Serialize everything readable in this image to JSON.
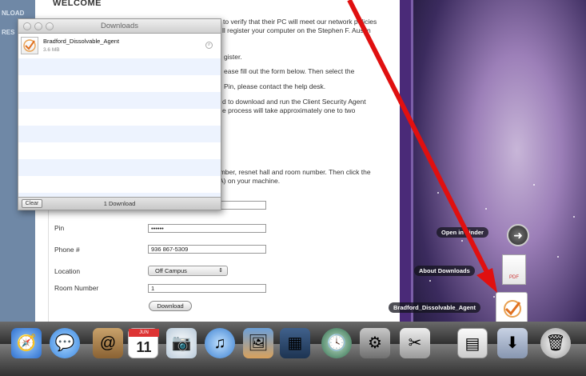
{
  "left_strip": {
    "tab_1": "NLOAD",
    "tab_2": "RES"
  },
  "webpage": {
    "heading": "WELCOME",
    "lines": [
      {
        "id": "l1",
        "text": "to verify that their PC will meet our network policies"
      },
      {
        "id": "l2",
        "text": "ll register your computer on the Stephen F. Austin"
      },
      {
        "id": "l3",
        "text": "gister."
      },
      {
        "id": "l4",
        "text": "ease fill out the form below. Then select the"
      },
      {
        "id": "l5",
        "text": "Pin, please contact the help desk."
      },
      {
        "id": "l6",
        "text": "d to download and run the Client Security Agent"
      },
      {
        "id": "l7",
        "text": "e process will take approximately one to two"
      },
      {
        "id": "l8",
        "text": "umber, resnet hall and room number. Then click the"
      },
      {
        "id": "l9",
        "text": "A) on your machine."
      }
    ],
    "form": {
      "pin_label": "Pin",
      "pin_value": "••••••",
      "phone_label": "Phone #",
      "phone_value": "936 867-5309",
      "location_label": "Location",
      "location_value": "Off Campus",
      "room_label": "Room Number",
      "room_value": "1",
      "download_button": "Download"
    }
  },
  "downloads_window": {
    "title": "Downloads",
    "item_name": "Bradford_Dissolvable_Agent",
    "item_size": "3.6 MB",
    "clear_button": "Clear",
    "count_label": "1 Download"
  },
  "desktop": {
    "open_in_finder": "Open in Finder",
    "about_downloads": "About Downloads",
    "pdf_label": "PDF",
    "agent_label": "Bradford_Dissolvable_Agent",
    "calendar_day": "11",
    "calendar_month": "JUN"
  },
  "icons": {
    "safari": "compass-icon",
    "ichat": "chat-bubble-icon",
    "address_book": "address-book-icon",
    "ical": "calendar-icon",
    "iphoto": "photo-icon",
    "itunes": "music-note-icon",
    "preview": "preview-icon",
    "spaces": "spaces-icon",
    "time_machine": "clock-icon",
    "system_prefs": "gear-icon",
    "utility": "scissors-icon",
    "documents_stack": "folder-stack-icon",
    "downloads_stack": "download-arrow-icon",
    "trash": "trash-icon"
  },
  "colors": {
    "arrow": "#e01010",
    "stripe": "#edf3fe",
    "purple_bar": "#4a2a78"
  }
}
